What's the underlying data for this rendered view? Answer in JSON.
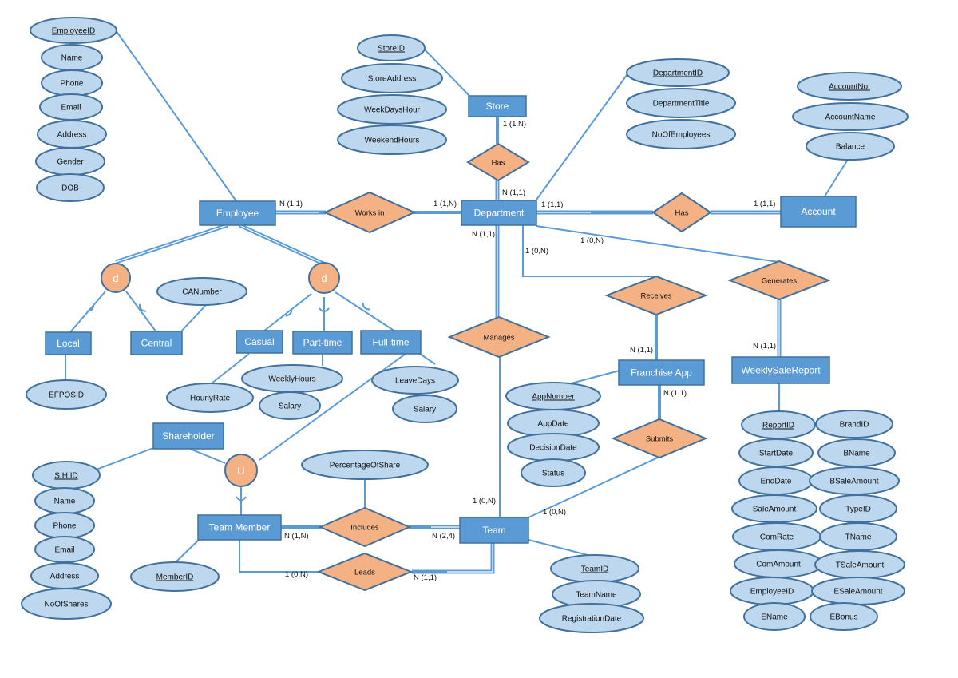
{
  "colors": {
    "entity_fill": "#5b9bd5",
    "entity_stroke": "#41719c",
    "attribute_fill": "#bdd7ee",
    "relationship_fill": "#f4b183",
    "line": "#5b9bd5"
  },
  "entities": [
    {
      "id": "employee",
      "label": "Employee"
    },
    {
      "id": "department",
      "label": "Department"
    },
    {
      "id": "store",
      "label": "Store"
    },
    {
      "id": "account",
      "label": "Account"
    },
    {
      "id": "local",
      "label": "Local"
    },
    {
      "id": "central",
      "label": "Central"
    },
    {
      "id": "casual",
      "label": "Casual"
    },
    {
      "id": "parttime",
      "label": "Part-time"
    },
    {
      "id": "fulltime",
      "label": "Full-time"
    },
    {
      "id": "franchise",
      "label": "Franchise App"
    },
    {
      "id": "weekly",
      "label": "WeeklySaleReport"
    },
    {
      "id": "shareholder",
      "label": "Shareholder"
    },
    {
      "id": "teammember",
      "label": "Team Member"
    },
    {
      "id": "team",
      "label": "Team"
    }
  ],
  "relationships": [
    {
      "id": "worksin",
      "label": "Works in"
    },
    {
      "id": "hasstore",
      "label": "Has"
    },
    {
      "id": "hasaccount",
      "label": "Has"
    },
    {
      "id": "manages",
      "label": "Manages"
    },
    {
      "id": "receives",
      "label": "Receives"
    },
    {
      "id": "generates",
      "label": "Generates"
    },
    {
      "id": "submits",
      "label": "Submits"
    },
    {
      "id": "includes",
      "label": "Includes"
    },
    {
      "id": "leads",
      "label": "Leads"
    }
  ],
  "specializations": [
    {
      "id": "spec1",
      "label": "d"
    },
    {
      "id": "spec2",
      "label": "d"
    },
    {
      "id": "union",
      "label": "U"
    }
  ],
  "attributes": [
    {
      "id": "emp_id",
      "label": "EmployeeID",
      "key": true
    },
    {
      "id": "emp_name",
      "label": "Name",
      "key": false
    },
    {
      "id": "emp_phone",
      "label": "Phone",
      "key": false
    },
    {
      "id": "emp_email",
      "label": "Email",
      "key": false
    },
    {
      "id": "emp_address",
      "label": "Address",
      "key": false
    },
    {
      "id": "emp_gender",
      "label": "Gender",
      "key": false
    },
    {
      "id": "emp_dob",
      "label": "DOB",
      "key": false
    },
    {
      "id": "store_id",
      "label": "StoreID",
      "key": true
    },
    {
      "id": "store_address",
      "label": "StoreAddress",
      "key": false
    },
    {
      "id": "store_weekdays",
      "label": "WeekDaysHour",
      "key": false
    },
    {
      "id": "store_weekend",
      "label": "WeekendHours",
      "key": false
    },
    {
      "id": "dept_id",
      "label": "DepartmentID",
      "key": true
    },
    {
      "id": "dept_title",
      "label": "DepartmentTitle",
      "key": false
    },
    {
      "id": "dept_noemp",
      "label": "NoOfEmployees",
      "key": false
    },
    {
      "id": "acc_no",
      "label": "AccountNo.",
      "key": true
    },
    {
      "id": "acc_name",
      "label": "AccountName",
      "key": false
    },
    {
      "id": "acc_balance",
      "label": "Balance",
      "key": false
    },
    {
      "id": "canumber",
      "label": "CANumber",
      "key": false
    },
    {
      "id": "efposid",
      "label": "EFPOSID",
      "key": false
    },
    {
      "id": "hourlyrate",
      "label": "HourlyRate",
      "key": false
    },
    {
      "id": "weeklyhours",
      "label": "WeeklyHours",
      "key": false
    },
    {
      "id": "pt_salary",
      "label": "Salary",
      "key": false
    },
    {
      "id": "leavedays",
      "label": "LeaveDays",
      "key": false
    },
    {
      "id": "ft_salary",
      "label": "Salary",
      "key": false
    },
    {
      "id": "app_number",
      "label": "AppNumber",
      "key": true
    },
    {
      "id": "app_date",
      "label": "AppDate",
      "key": false
    },
    {
      "id": "decision_date",
      "label": "DecisionDate",
      "key": false
    },
    {
      "id": "app_status",
      "label": "Status",
      "key": false
    },
    {
      "id": "sh_id",
      "label": "S.H.ID",
      "key": true
    },
    {
      "id": "sh_name",
      "label": "Name",
      "key": false
    },
    {
      "id": "sh_phone",
      "label": "Phone",
      "key": false
    },
    {
      "id": "sh_email",
      "label": "Email",
      "key": false
    },
    {
      "id": "sh_address",
      "label": "Address",
      "key": false
    },
    {
      "id": "sh_noshares",
      "label": "NoOfShares",
      "key": false
    },
    {
      "id": "member_id",
      "label": "MemberID",
      "key": true
    },
    {
      "id": "pct_share",
      "label": "PercentageOfShare",
      "key": false
    },
    {
      "id": "team_id",
      "label": "TeamID",
      "key": true
    },
    {
      "id": "team_name",
      "label": "TeamName",
      "key": false
    },
    {
      "id": "team_reg",
      "label": "RegistrationDate",
      "key": false
    },
    {
      "id": "report_id",
      "label": "ReportID",
      "key": true
    },
    {
      "id": "brand_id",
      "label": "BrandID",
      "key": false
    },
    {
      "id": "start_date",
      "label": "StartDate",
      "key": false
    },
    {
      "id": "bname",
      "label": "BName",
      "key": false
    },
    {
      "id": "end_date",
      "label": "EndDate",
      "key": false
    },
    {
      "id": "bsale",
      "label": "BSaleAmount",
      "key": false
    },
    {
      "id": "sale_amount",
      "label": "SaleAmount",
      "key": false
    },
    {
      "id": "type_id",
      "label": "TypeID",
      "key": false
    },
    {
      "id": "com_rate",
      "label": "ComRate",
      "key": false
    },
    {
      "id": "tname",
      "label": "TName",
      "key": false
    },
    {
      "id": "com_amount",
      "label": "ComAmount",
      "key": false
    },
    {
      "id": "tsale",
      "label": "TSaleAmount",
      "key": false
    },
    {
      "id": "wr_emp_id",
      "label": "EmployeeID",
      "key": false
    },
    {
      "id": "esale",
      "label": "ESaleAmount",
      "key": false
    },
    {
      "id": "ename",
      "label": "EName",
      "key": false
    },
    {
      "id": "ebonus",
      "label": "EBonus",
      "key": false
    }
  ],
  "cardinalities": [
    {
      "id": "c_emp_worksin",
      "label": "N (1,1)"
    },
    {
      "id": "c_dept_worksin",
      "label": "1 (1,N)"
    },
    {
      "id": "c_store_has",
      "label": "1 (1,N)"
    },
    {
      "id": "c_dept_has_store",
      "label": "N (1,1)"
    },
    {
      "id": "c_dept_has_acc",
      "label": "1 (1,1)"
    },
    {
      "id": "c_acc_has",
      "label": "1 (1,1)"
    },
    {
      "id": "c_dept_manages",
      "label": "N (1,1)"
    },
    {
      "id": "c_dept_receives",
      "label": "1 (0,N)"
    },
    {
      "id": "c_dept_generates",
      "label": "1 (0,N)"
    },
    {
      "id": "c_franchise_receives",
      "label": "N (1,1)"
    },
    {
      "id": "c_weekly_generates",
      "label": "N (1,1)"
    },
    {
      "id": "c_franchise_submits",
      "label": "N (1,1)"
    },
    {
      "id": "c_team_manages",
      "label": "1 (0,N)"
    },
    {
      "id": "c_team_submits",
      "label": "1 (0,N)"
    },
    {
      "id": "c_tm_includes",
      "label": "N (1,N)"
    },
    {
      "id": "c_team_includes",
      "label": "N (2,4)"
    },
    {
      "id": "c_tm_leads",
      "label": "1 (0,N)"
    },
    {
      "id": "c_team_leads",
      "label": "N (1,1)"
    }
  ]
}
